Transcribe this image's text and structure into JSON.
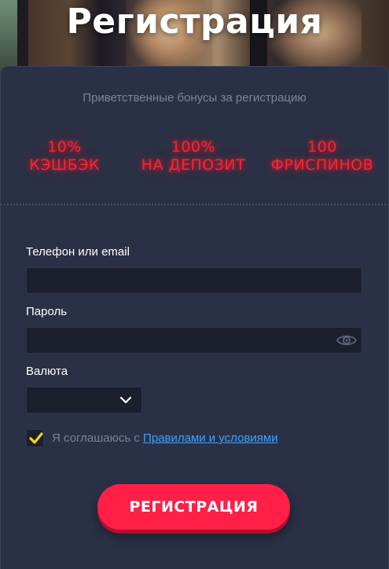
{
  "hero": {
    "title": "Регистрация"
  },
  "bonus_section": {
    "subtitle": "Приветственные бонусы за регистрацию",
    "items": [
      {
        "amount": "10%",
        "label": "КЭШБЭК"
      },
      {
        "amount": "100%",
        "label": "НА ДЕПОЗИТ"
      },
      {
        "amount": "100",
        "label": "ФРИСПИНОВ"
      }
    ]
  },
  "form": {
    "phone_label": "Телефон или email",
    "phone_value": "",
    "password_label": "Пароль",
    "password_value": "",
    "currency_label": "Валюта",
    "currency_value": "",
    "agree_text": "Я соглашаюсь с ",
    "agree_link": "Правилами и условиями",
    "agree_checked": true,
    "submit_label": "РЕГИСТРАЦИЯ"
  },
  "colors": {
    "background": "#2a3146",
    "input_background": "#1b1f2e",
    "bonus_neon": "#ff2233",
    "button": "#ff1f47",
    "link": "#3da3ff",
    "checkbox_mark": "#f5d90a"
  },
  "icons": [
    "eye-icon",
    "chevron-down-icon",
    "checkmark-icon"
  ]
}
